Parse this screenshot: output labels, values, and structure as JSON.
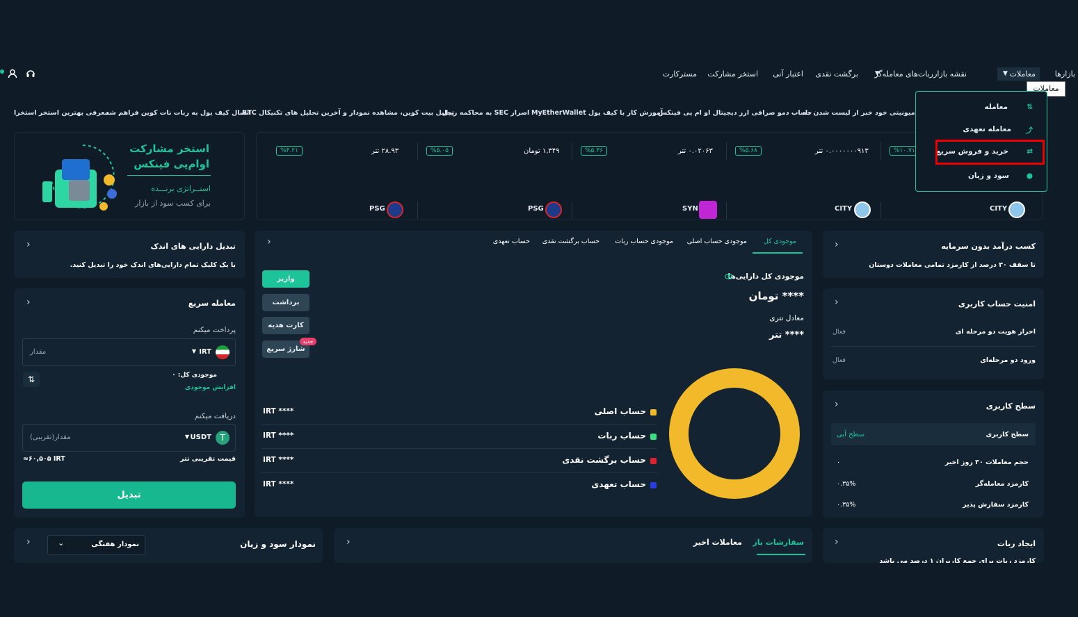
{
  "header": {
    "nav": [
      "بازارها",
      "معاملات",
      "نقشه بازار",
      "ربات‌های معامله‌گر",
      "برگشت نقدی",
      "اعتبار آنی",
      "استخر مشارکت",
      "مسترکارت"
    ],
    "tooltip": "معاملات"
  },
  "dropdown": {
    "items": [
      "معامله",
      "معامله تعهدی",
      "خرید و فروش سریع",
      "سود و زیان"
    ]
  },
  "ticker": [
    "معرفی بهترین استخر استخرا",
    "اتصال کیف پول به ربات نات کوین فراهم شد",
    "تحلیل بیت کوین، مشاهده نمودار و آخرین تحلیل های تکنیکال BTC",
    "اصرار SEC به محاکمه ریپل",
    "آموزش کار با کیف پول MyEtherWallet",
    "حساب دمو صرافی ارز دیجیتال او ام پی فینکس",
    "ن در کامیونیتی خود خبر از لیست شدن داد"
  ],
  "banner": {
    "title1": "استخر مشارکت",
    "title2": "اوام‌پی فینکس",
    "sub1": "استــراتژی برنـــده",
    "sub2": "برای کسب سود از بازار"
  },
  "prices": [
    {
      "change": "%۱۰.۷۱",
      "price": "۰.۰۰۰۰۰۰۰۹۱۳ تتر"
    },
    {
      "change": "%۵.۶۸",
      "price": "۰.۰۲۰۶۳ تتر"
    },
    {
      "change": "%۵.۳۶",
      "price": "۱,۳۴۹ تومان"
    },
    {
      "change": "%۵.۰۵",
      "price": "۲۸.۹۳ تتر"
    },
    {
      "change": "%۴.۲۱",
      "price": ""
    }
  ],
  "coins": [
    "CITY",
    "CITY",
    "SYN",
    "PSG",
    "PSG"
  ],
  "earn": {
    "title": "کسب درآمد بدون سرمایه",
    "desc": "تا سقف ۳۰ درصد از کارمزد تمامی معاملات دوستان"
  },
  "security": {
    "title": "امنیت حساب کاربری",
    "rows": [
      {
        "label": "احراز هویت دو مرحله ای",
        "value": "فعال"
      },
      {
        "label": "ورود دو مرحله‌ای",
        "value": "فعال"
      }
    ]
  },
  "level": {
    "title": "سطح کاربری",
    "rows": [
      {
        "label": "سطح کاربری",
        "value": "سطح آبی"
      },
      {
        "label": "حجم معاملات ۳۰ روز اخیر",
        "value": "۰"
      },
      {
        "label": "کارمزد معامله‌گر",
        "value": "۰.۳۵%"
      },
      {
        "label": "کارمزد سفارش پذیر",
        "value": "۰.۳۵%"
      }
    ]
  },
  "bot": {
    "title": "ایجاد ربات",
    "desc": "کارمزد ربات برای جمع کاربران ۱ درصد می باشد"
  },
  "center": {
    "tabs": [
      "موجودی کل",
      "موجودی حساب اصلی",
      "موجودی حساب ربات",
      "حساب برگشت نقدی",
      "حساب تعهدی"
    ],
    "total_label": "موجودی کل دارایی‌ها",
    "total_value": "**** تومان",
    "tether_label": "معادل تتری",
    "tether_value": "**** تتر",
    "buttons": [
      "واریز",
      "برداشت",
      "کارت هدیه",
      "شارژ سریع"
    ],
    "new_badge": "جدید",
    "legend": [
      {
        "label": "حساب اصلی",
        "value": "**** IRT",
        "color": "#f2b92a"
      },
      {
        "label": "حساب ربات",
        "value": "**** IRT",
        "color": "#3ddc84"
      },
      {
        "label": "حساب برگشت نقدی",
        "value": "**** IRT",
        "color": "#e0222e"
      },
      {
        "label": "حساب تعهدی",
        "value": "**** IRT",
        "color": "#2a3de0"
      }
    ]
  },
  "small_assets": {
    "title": "تبدیل دارایی های اندک",
    "desc": "با یک کلیک تمام دارایی‌های اندک خود را تبدیل کنید."
  },
  "quick": {
    "title": "معامله سریع",
    "pay_label": "پرداخت میکنم",
    "pay_currency": "IRT",
    "pay_placeholder": "مقدار",
    "balance": "موجودی کل: ۰",
    "increase": "افزایش موجودی",
    "receive_label": "دریافت میکنم",
    "receive_currency": "USDT",
    "receive_placeholder": "مقدار(تقریبی)",
    "rate_label": "قیمت تقریبی تتر",
    "rate_value": "≈۶۰,۵۰۵ IRT",
    "convert": "تبدیل"
  },
  "bottom": {
    "orders_tabs": [
      "سفارشات باز",
      "معاملات اخیر"
    ],
    "pnl_title": "نمودار سود و زیان",
    "pnl_select": "نمودار هفتگی"
  }
}
